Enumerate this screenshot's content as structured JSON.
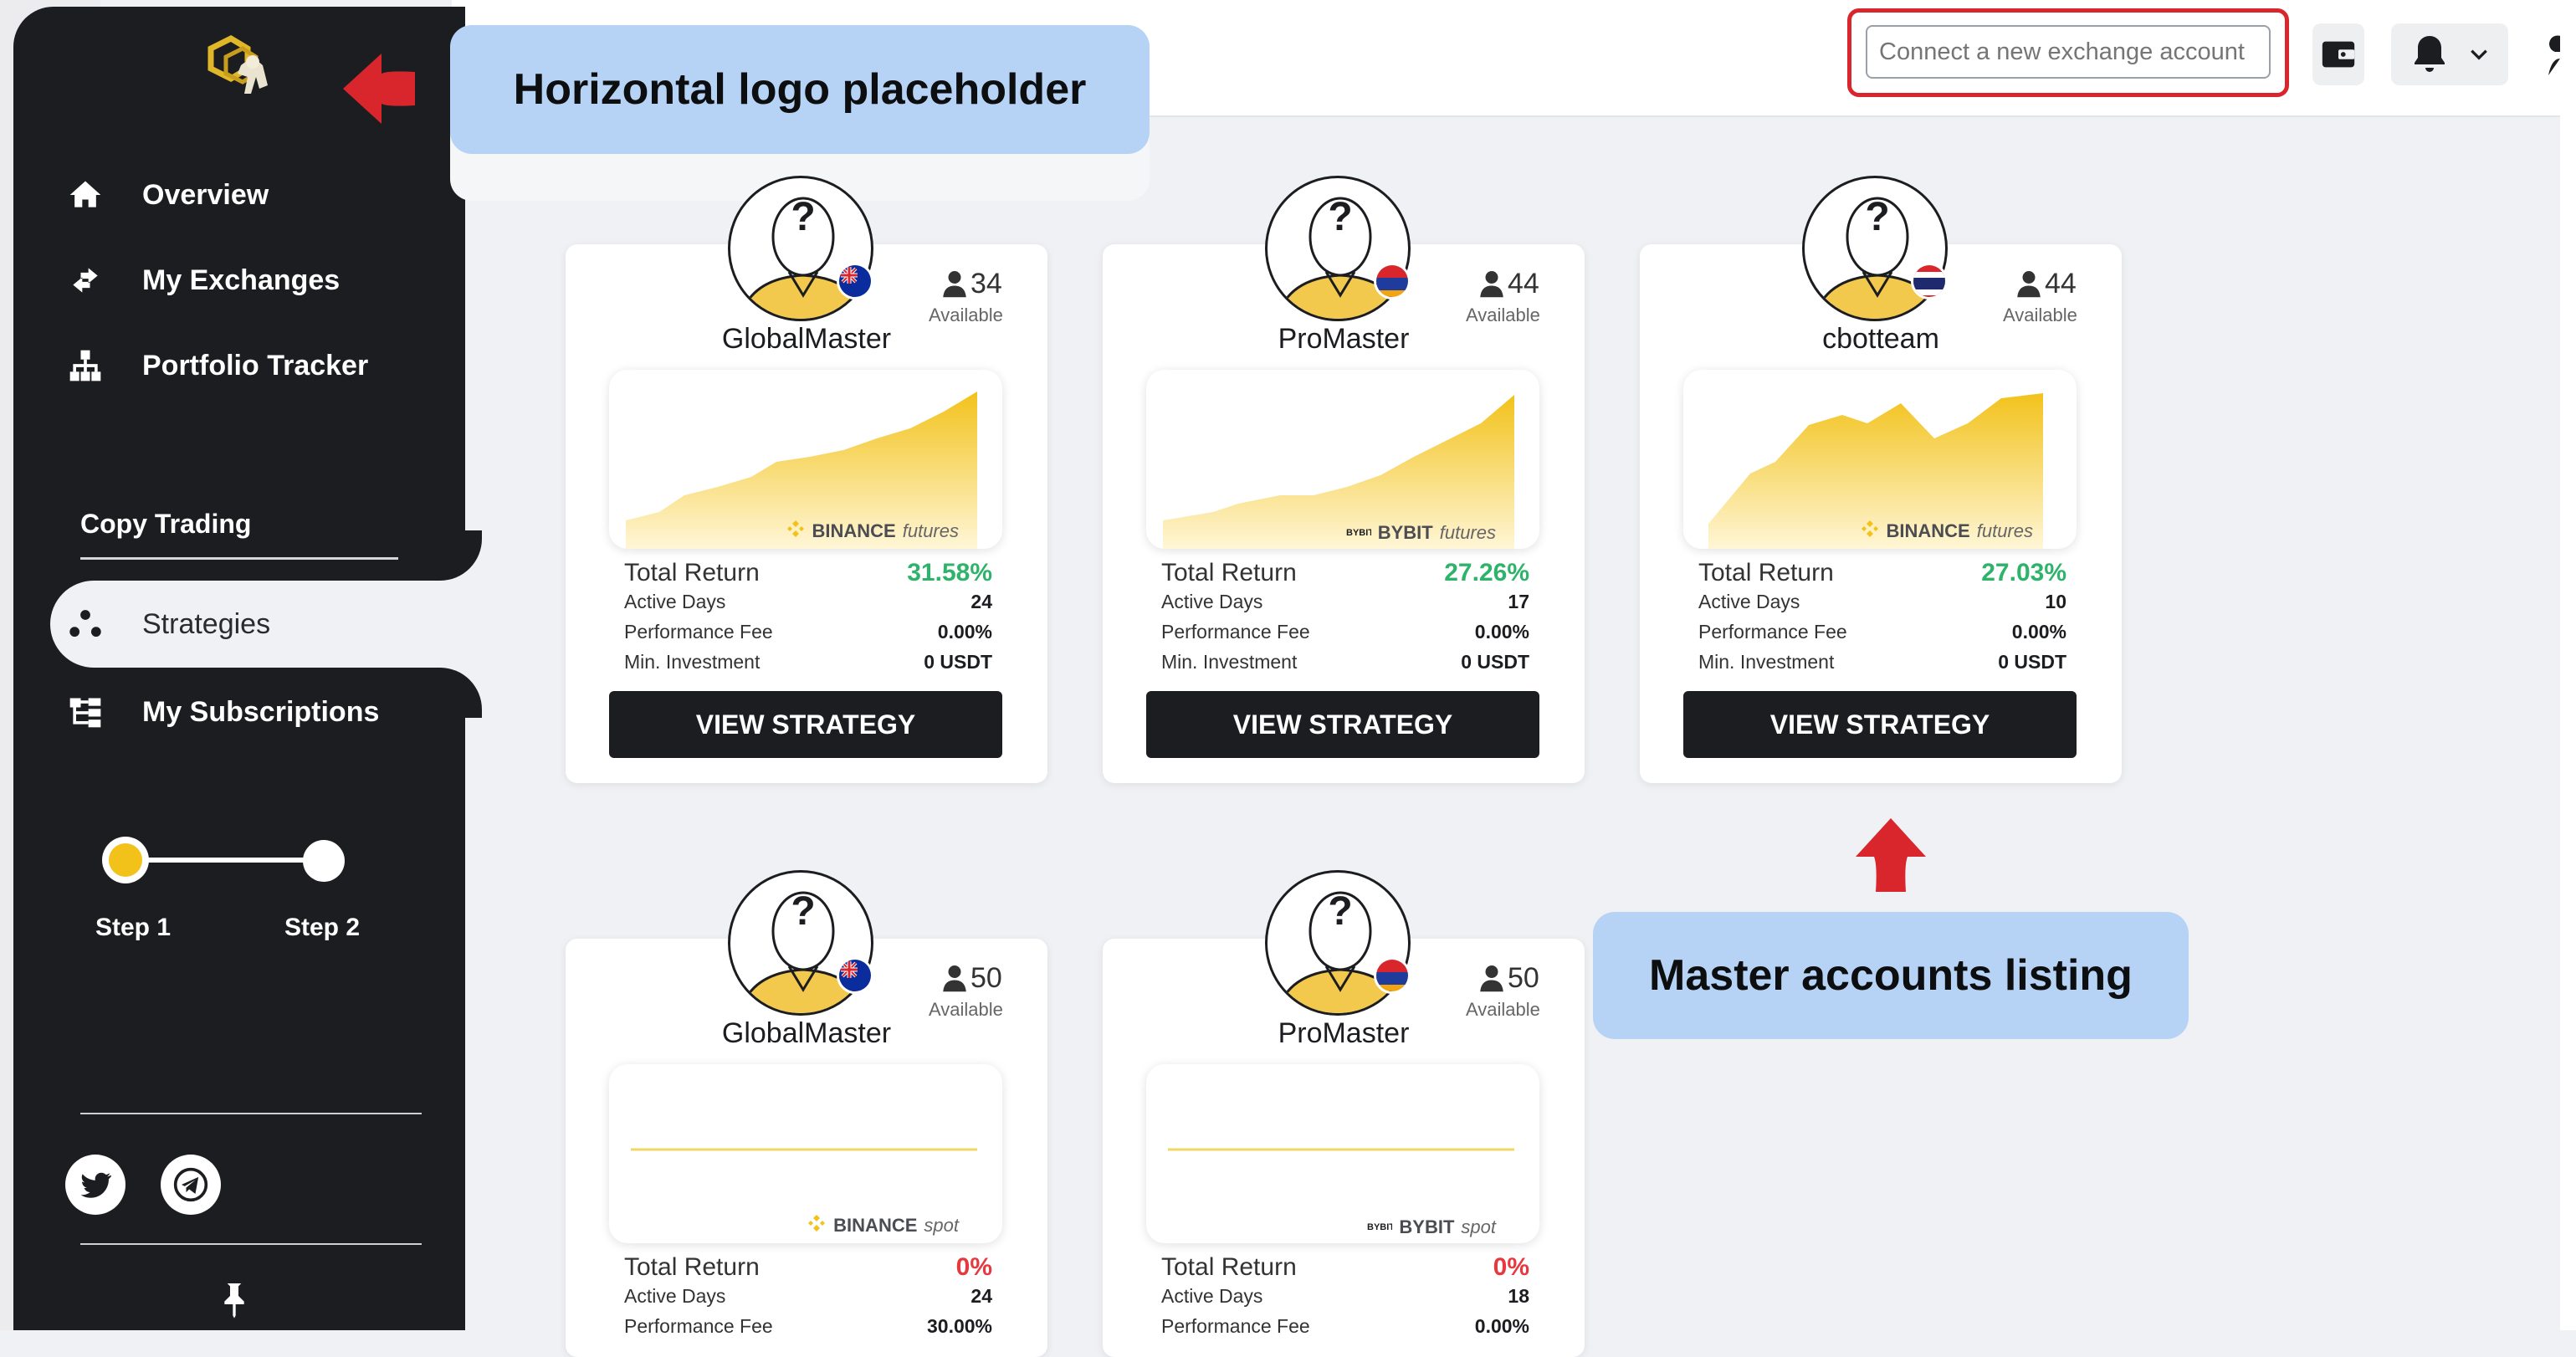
{
  "sidebar": {
    "nav": [
      {
        "label": "Overview",
        "icon": "home-icon"
      },
      {
        "label": "My Exchanges",
        "icon": "exchange-arrows-icon"
      },
      {
        "label": "Portfolio Tracker",
        "icon": "sitemap-icon"
      }
    ],
    "section_title": "Copy Trading",
    "copy_nav": [
      {
        "label": "Strategies",
        "icon": "strategies-dots-icon",
        "active": true
      },
      {
        "label": "My Subscriptions",
        "icon": "subscriptions-tree-icon"
      }
    ],
    "steps": [
      {
        "label": "Step 1",
        "active": true
      },
      {
        "label": "Step 2",
        "active": false
      }
    ],
    "social": [
      "twitter-icon",
      "telegram-icon"
    ],
    "pin_icon": "pin-icon"
  },
  "callouts": {
    "logo": "Horizontal logo placeholder",
    "listing": "Master accounts listing"
  },
  "topbar": {
    "connect_placeholder": "Connect a new exchange account",
    "wallet_icon": "wallet-icon",
    "bell_icon": "bell-icon",
    "chevron_icon": "chevron-down-icon"
  },
  "labels": {
    "available": "Available",
    "total_return": "Total Return",
    "active_days": "Active Days",
    "performance_fee": "Performance Fee",
    "min_investment": "Min. Investment",
    "view_strategy": "VIEW STRATEGY"
  },
  "cards": [
    {
      "name": "GlobalMaster",
      "available": "34",
      "exchange": "BINANCE",
      "market": "futures",
      "total_return": "31.58%",
      "active_days": "24",
      "performance_fee": "0.00%",
      "min_investment": "0 USDT",
      "return_color": "#2fb36b",
      "flag": "new-zealand"
    },
    {
      "name": "ProMaster",
      "available": "44",
      "exchange": "BYBIT",
      "market": "futures",
      "total_return": "27.26%",
      "active_days": "17",
      "performance_fee": "0.00%",
      "min_investment": "0 USDT",
      "return_color": "#2fb36b",
      "flag": "armenia"
    },
    {
      "name": "cbotteam",
      "available": "44",
      "exchange": "BINANCE",
      "market": "futures",
      "total_return": "27.03%",
      "active_days": "10",
      "performance_fee": "0.00%",
      "min_investment": "0 USDT",
      "return_color": "#2fb36b",
      "flag": "thailand"
    },
    {
      "name": "GlobalMaster",
      "available": "50",
      "exchange": "BINANCE",
      "market": "spot",
      "total_return": "0%",
      "active_days": "24",
      "performance_fee": "30.00%",
      "return_color": "#e5393f",
      "flag": "new-zealand"
    },
    {
      "name": "ProMaster",
      "available": "50",
      "exchange": "BYBIT",
      "market": "spot",
      "total_return": "0%",
      "active_days": "18",
      "performance_fee": "0.00%",
      "return_color": "#e5393f",
      "flag": "armenia"
    }
  ],
  "colors": {
    "sidebar_bg": "#1c1d20",
    "accent_yellow": "#f2c21b",
    "positive": "#2fb36b",
    "negative": "#e5393f",
    "callout_bg": "#b6d3f6",
    "highlight_red": "#d9262c"
  }
}
